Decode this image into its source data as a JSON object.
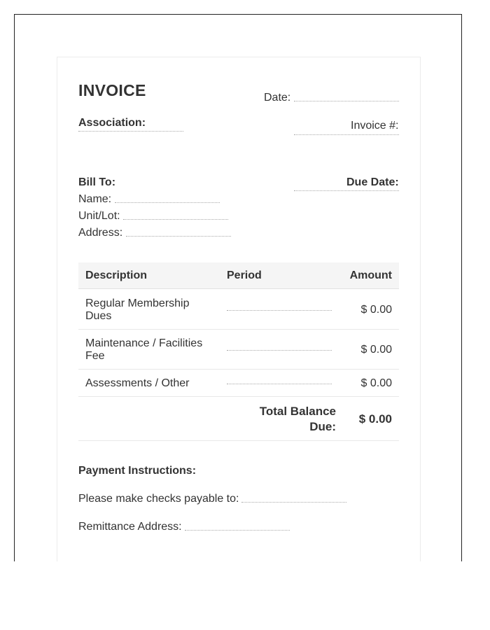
{
  "invoice": {
    "title": "INVOICE",
    "date_label": "Date:",
    "association_label": "Association:",
    "invoice_number_label": "Invoice #:",
    "bill_to_label": "Bill To:",
    "due_date_label": "Due Date:",
    "name_label": "Name:",
    "unit_lot_label": "Unit/Lot:",
    "address_label": "Address:"
  },
  "table": {
    "headers": [
      "Description",
      "Period",
      "Amount"
    ],
    "rows": [
      {
        "description": "Regular Membership Dues",
        "amount": "$ 0.00"
      },
      {
        "description": "Maintenance / Facilities Fee",
        "amount": "$ 0.00"
      },
      {
        "description": "Assessments / Other",
        "amount": "$ 0.00"
      }
    ],
    "total_label": "Total Balance Due:",
    "total_value": "$ 0.00"
  },
  "payment": {
    "heading": "Payment Instructions:",
    "payable_label": "Please make checks payable to:",
    "remittance_label": "Remittance Address:"
  }
}
